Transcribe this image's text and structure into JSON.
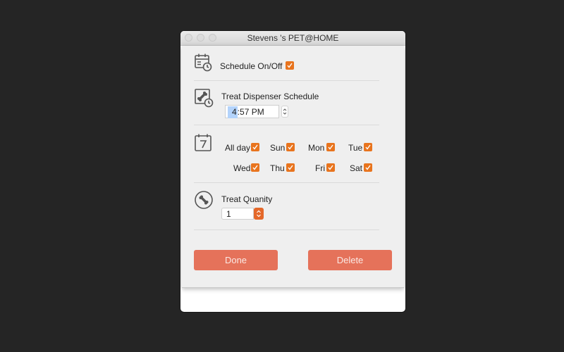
{
  "window": {
    "title": "Stevens 's PET@HOME"
  },
  "schedule": {
    "label": "Schedule On/Off",
    "checked": true
  },
  "dispenser": {
    "label": "Treat Dispenser Schedule",
    "time_hour": "4",
    "time_rest": ":57 PM"
  },
  "days": {
    "all_day": {
      "label": "All day",
      "checked": true
    },
    "items": [
      {
        "label": "Sun",
        "checked": true
      },
      {
        "label": "Mon",
        "checked": true
      },
      {
        "label": "Tue",
        "checked": true
      },
      {
        "label": "Wed",
        "checked": true
      },
      {
        "label": "Thu",
        "checked": true
      },
      {
        "label": "Fri",
        "checked": true
      },
      {
        "label": "Sat",
        "checked": true
      }
    ]
  },
  "quantity": {
    "label": "Treat Quanity",
    "value": "1"
  },
  "buttons": {
    "done": "Done",
    "delete": "Delete"
  },
  "colors": {
    "accent": "#e8741e",
    "button": "#e5725a"
  }
}
